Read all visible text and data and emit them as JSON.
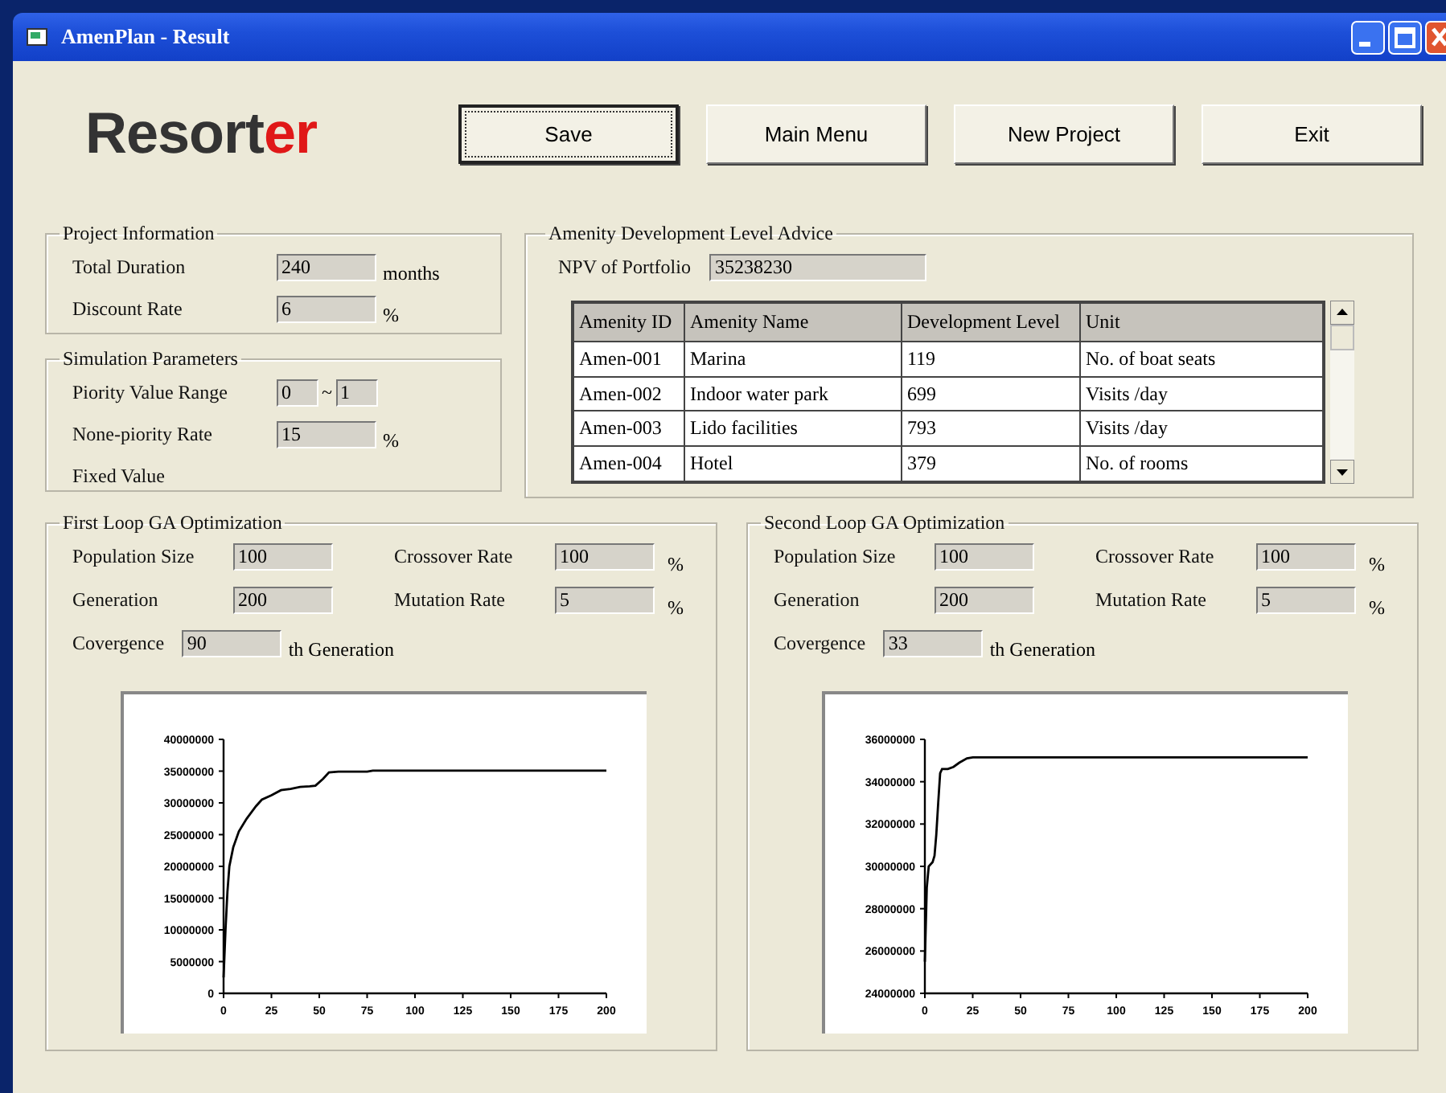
{
  "window": {
    "title": "AmenPlan - Result"
  },
  "logo": {
    "text_main": "Resort",
    "text_accent": "er"
  },
  "buttons": [
    {
      "label": "Save",
      "focused": true
    },
    {
      "label": "Main Menu",
      "focused": false
    },
    {
      "label": "New Project",
      "focused": false
    },
    {
      "label": "Exit",
      "focused": false
    }
  ],
  "project_info": {
    "title": "Project Information",
    "fields": [
      {
        "label": "Total Duration",
        "value": "240",
        "unit": "months"
      },
      {
        "label": "Discount Rate",
        "value": "6",
        "unit": "%"
      }
    ]
  },
  "simulation": {
    "title": "Simulation Parameters",
    "rows": [
      {
        "kind": "range",
        "label": "Piority Value Range",
        "values": [
          "0",
          "1"
        ],
        "separator": "~"
      },
      {
        "kind": "field",
        "label": "None-piority Rate",
        "value": "15",
        "unit": "%"
      },
      {
        "kind": "label",
        "label": "Fixed Value"
      }
    ]
  },
  "amenity": {
    "title": "Amenity Development Level Advice",
    "npv_label": "NPV of Portfolio",
    "npv_value": "35238230",
    "table": {
      "columns": [
        "Amenity ID",
        "Amenity Name",
        "Development Level",
        "Unit"
      ],
      "rows": [
        [
          "Amen-001",
          "Marina",
          "119",
          "No. of boat seats"
        ],
        [
          "Amen-002",
          "Indoor water park",
          "699",
          "Visits /day"
        ],
        [
          "Amen-003",
          "Lido facilities",
          "793",
          "Visits /day"
        ],
        [
          "Amen-004",
          "Hotel",
          "379",
          "No. of rooms"
        ]
      ]
    }
  },
  "loops": [
    {
      "title": "First Loop GA Optimization",
      "fields": [
        {
          "label": "Population Size",
          "value": "100"
        },
        {
          "label": "Crossover Rate",
          "value": "100",
          "unit": "%"
        },
        {
          "label": "Generation",
          "value": "200"
        },
        {
          "label": "Mutation Rate",
          "value": "5",
          "unit": "%"
        },
        {
          "label": "Covergence",
          "value": "90",
          "unit": "th Generation"
        }
      ],
      "chart_data": {
        "type": "line",
        "x": [
          0,
          1,
          2,
          3,
          5,
          8,
          12,
          17,
          20,
          25,
          30,
          35,
          40,
          45,
          48,
          52,
          55,
          60,
          75,
          78,
          100,
          125,
          150,
          175,
          200
        ],
        "series": [
          {
            "color": "#000000",
            "values": [
              2500000,
              10000000,
              16000000,
              20000000,
              23000000,
              25500000,
              27500000,
              29500000,
              30500000,
              31200000,
              32000000,
              32200000,
              32500000,
              32600000,
              32700000,
              33800000,
              34800000,
              34900000,
              34900000,
              35100000,
              35100000,
              35100000,
              35100000,
              35100000,
              35100000
            ]
          }
        ],
        "xlim": [
          0,
          200
        ],
        "ylim": [
          0,
          40000000
        ],
        "xticks": [
          0,
          25,
          50,
          75,
          100,
          125,
          150,
          175,
          200
        ],
        "yticks": [
          0,
          5000000,
          10000000,
          15000000,
          20000000,
          25000000,
          30000000,
          35000000,
          40000000
        ]
      }
    },
    {
      "title": "Second Loop GA Optimization",
      "fields": [
        {
          "label": "Population Size",
          "value": "100"
        },
        {
          "label": "Crossover Rate",
          "value": "100",
          "unit": "%"
        },
        {
          "label": "Generation",
          "value": "200"
        },
        {
          "label": "Mutation Rate",
          "value": "5",
          "unit": "%"
        },
        {
          "label": "Covergence",
          "value": "33",
          "unit": "th Generation"
        }
      ],
      "chart_data": {
        "type": "line",
        "x": [
          0,
          1,
          2,
          4,
          5,
          6,
          7,
          8,
          9,
          12,
          15,
          18,
          22,
          25,
          33,
          200
        ],
        "series": [
          {
            "color": "#000000",
            "values": [
              25500000,
              29000000,
              30000000,
              30200000,
              30500000,
              31500000,
              33000000,
              34400000,
              34600000,
              34600000,
              34700000,
              34900000,
              35100000,
              35150000,
              35150000,
              35150000
            ]
          }
        ],
        "xlim": [
          0,
          200
        ],
        "ylim": [
          24000000,
          36000000
        ],
        "xticks": [
          0,
          25,
          50,
          75,
          100,
          125,
          150,
          175,
          200
        ],
        "yticks": [
          24000000,
          26000000,
          28000000,
          30000000,
          32000000,
          34000000,
          36000000
        ]
      }
    }
  ]
}
